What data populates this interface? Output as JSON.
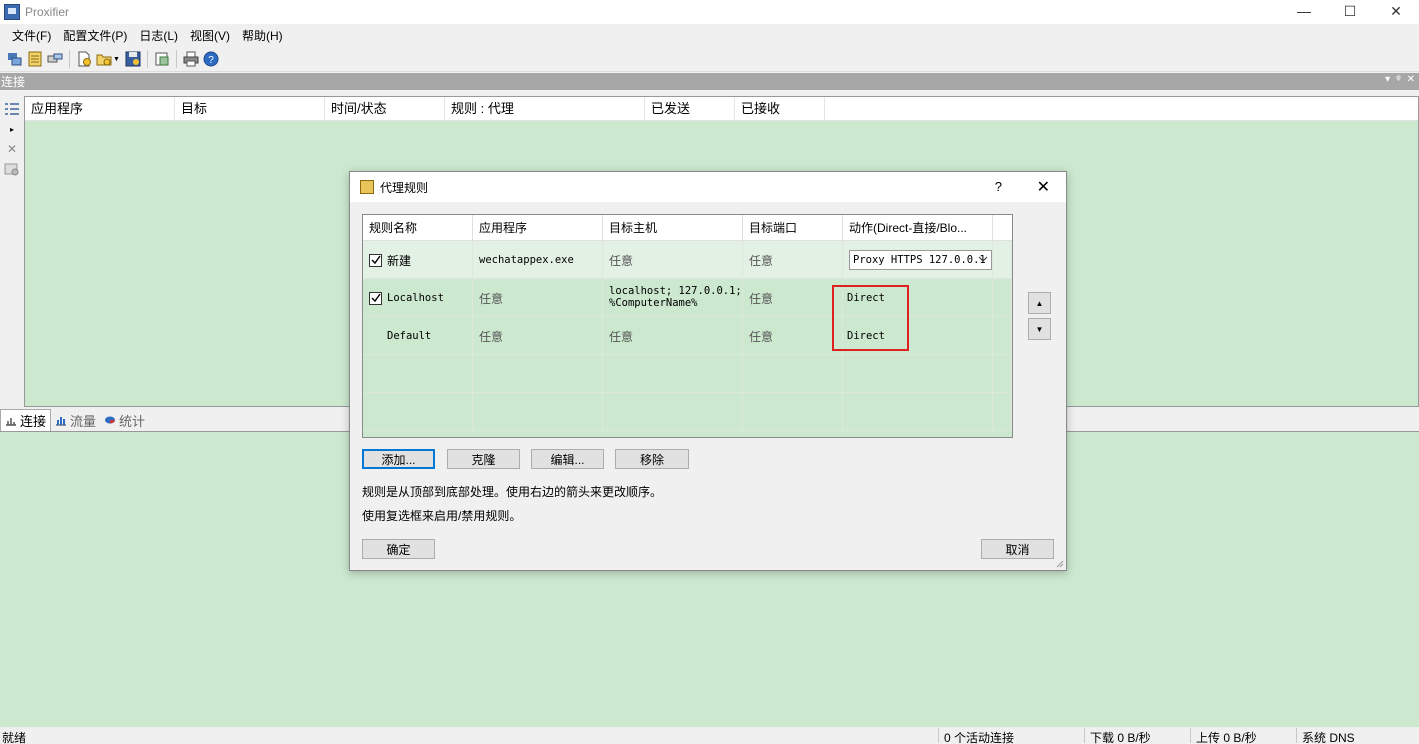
{
  "window": {
    "title": "Proxifier",
    "controls": {
      "minimize": "—",
      "maximize": "☐",
      "close": "✕"
    }
  },
  "menu": {
    "items": [
      {
        "label": "文件(F)"
      },
      {
        "label": "配置文件(P)"
      },
      {
        "label": "日志(L)"
      },
      {
        "label": "视图(V)"
      },
      {
        "label": "帮助(H)"
      }
    ]
  },
  "toolbar": {
    "icons": [
      "connections-icon",
      "rules-icon",
      "proxy-servers-icon",
      "new-profile-icon",
      "open-profile-icon",
      "save-profile-icon",
      "export-icon",
      "print-icon",
      "help-icon"
    ]
  },
  "connections_panel": {
    "title": "连接",
    "header_buttons": {
      "dropdown": "▾",
      "pin": "ᵠ",
      "close": "✕"
    },
    "columns": [
      {
        "label": "应用程序"
      },
      {
        "label": "目标"
      },
      {
        "label": "时间/状态"
      },
      {
        "label": "规则 : 代理"
      },
      {
        "label": "已发送"
      },
      {
        "label": "已接收"
      }
    ]
  },
  "bottom_tabs": [
    {
      "label": "连接",
      "active": true
    },
    {
      "label": "流量",
      "active": false
    },
    {
      "label": "统计",
      "active": false
    }
  ],
  "statusbar": {
    "ready": "就绪",
    "active_connections": "0 个活动连接",
    "download": "下载 0 B/秒",
    "upload": "上传 0 B/秒",
    "dns": "系统 DNS"
  },
  "dialog": {
    "title": "代理规则",
    "help": "?",
    "close": "✕",
    "table": {
      "columns": [
        {
          "label": "规则名称"
        },
        {
          "label": "应用程序"
        },
        {
          "label": "目标主机"
        },
        {
          "label": "目标端口"
        },
        {
          "label": "动作(Direct-直接/Blo..."
        }
      ],
      "rows": [
        {
          "enabled": true,
          "has_checkbox": true,
          "name": "新建",
          "app": "wechatappex.exe",
          "host": "任意",
          "port": "任意",
          "action": "Proxy HTTPS 127.0.0.1"
        },
        {
          "enabled": true,
          "has_checkbox": true,
          "name": "Localhost",
          "app": "任意",
          "host": "localhost; 127.0.0.1;\n%ComputerName%",
          "port": "任意",
          "action": "Direct"
        },
        {
          "enabled": false,
          "has_checkbox": false,
          "name": "Default",
          "app": "任意",
          "host": "任意",
          "port": "任意",
          "action": "Direct"
        }
      ]
    },
    "move_up": "▲",
    "move_down": "▼",
    "buttons": {
      "add": "添加...",
      "clone": "克隆",
      "edit": "编辑...",
      "remove": "移除",
      "ok": "确定",
      "cancel": "取消"
    },
    "notes": [
      "规则是从顶部到底部处理。使用右边的箭头来更改顺序。",
      "使用复选框来启用/禁用规则。"
    ]
  }
}
